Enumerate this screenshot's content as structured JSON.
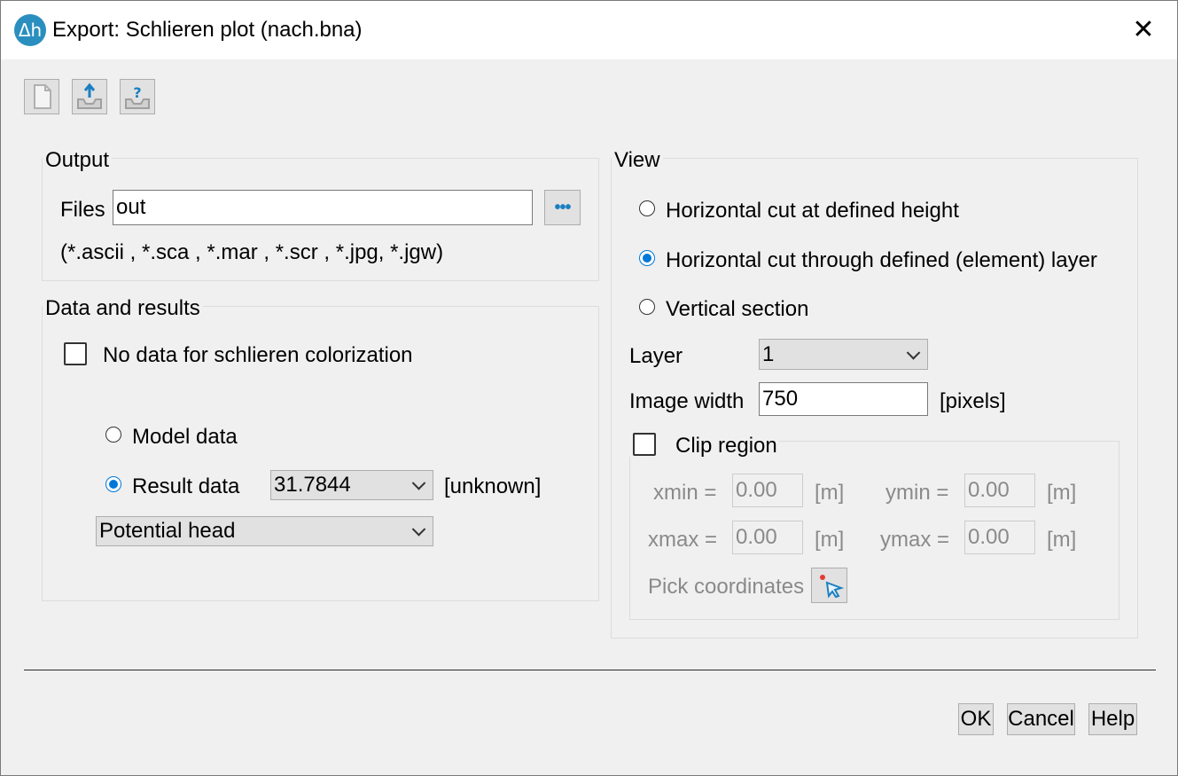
{
  "window": {
    "title": "Export: Schlieren plot (nach.bna)",
    "app_icon_text": "Δh",
    "close_glyph": "✕"
  },
  "toolbar": {
    "icons": [
      "new-file-icon",
      "export-icon",
      "export-help-icon"
    ]
  },
  "output": {
    "label": "Output",
    "files_label": "Files",
    "files_value": "out",
    "browse_glyph": "•••",
    "extensions": "(*.ascii , *.sca , *.mar , *.scr , *.jpg, *.jgw)"
  },
  "data_results": {
    "label": "Data and results",
    "no_data_label": "No data for schlieren colorization",
    "no_data_checked": false,
    "model_data_label": "Model data",
    "result_data_label": "Result data",
    "selected": "Result data",
    "result_value": "31.7844",
    "unit": "[unknown]",
    "quantity": "Potential head"
  },
  "view": {
    "label": "View",
    "options": [
      "Horizontal cut at defined height",
      "Horizontal cut through defined (element) layer",
      "Vertical section"
    ],
    "selected": "Horizontal cut through defined (element) layer",
    "layer_label": "Layer",
    "layer_value": "1",
    "image_width_label": "Image width",
    "image_width_value": "750",
    "image_width_unit": "[pixels]",
    "clip": {
      "label": "Clip region",
      "checked": false,
      "xmin_label": "xmin =",
      "xmin_value": "0.00",
      "ymin_label": "ymin =",
      "ymin_value": "0.00",
      "xmax_label": "xmax =",
      "xmax_value": "0.00",
      "ymax_label": "ymax =",
      "ymax_value": "0.00",
      "unit": "[m]",
      "pick_label": "Pick coordinates"
    }
  },
  "buttons": {
    "ok": "OK",
    "cancel": "Cancel",
    "help": "Help"
  },
  "colors": {
    "accent": "#0078d7",
    "app_icon": "#2a8fbf"
  }
}
